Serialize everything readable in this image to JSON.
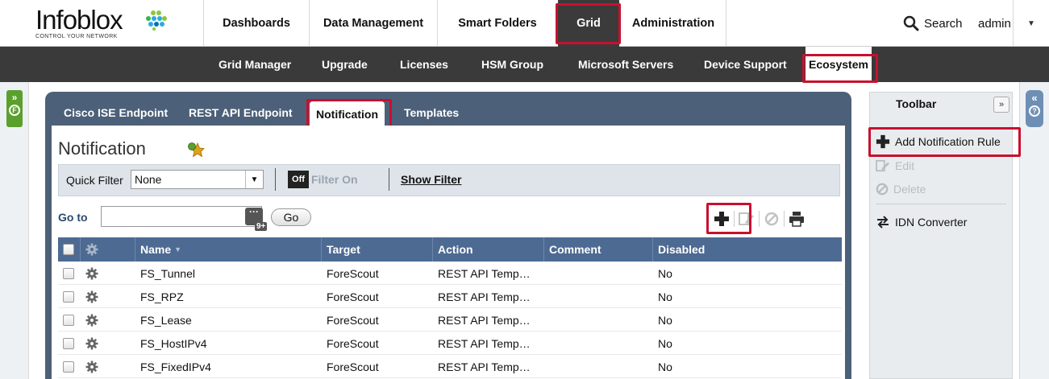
{
  "brand": {
    "name": "Infoblox",
    "tagline": "CONTROL YOUR NETWORK"
  },
  "top_nav": {
    "items": [
      "Dashboards",
      "Data Management",
      "Smart Folders",
      "Grid",
      "Administration"
    ],
    "active": "Grid",
    "search_label": "Search",
    "user": "admin"
  },
  "sub_nav": {
    "items": [
      "Grid Manager",
      "Upgrade",
      "Licenses",
      "HSM Group",
      "Microsoft Servers",
      "Device Support",
      "Ecosystem"
    ],
    "active": "Ecosystem"
  },
  "tabs": {
    "items": [
      "Cisco ISE Endpoint",
      "REST API Endpoint",
      "Notification",
      "Templates"
    ],
    "active": "Notification"
  },
  "page": {
    "title": "Notification"
  },
  "filter": {
    "quick_filter_label": "Quick Filter",
    "quick_filter_value": "None",
    "toggle_label": "Off",
    "filter_on_label": "Filter On",
    "show_filter_label": "Show Filter"
  },
  "goto": {
    "label": "Go to",
    "value": "",
    "more_badge": "9+",
    "go_label": "Go"
  },
  "table": {
    "columns": [
      "Name",
      "Target",
      "Action",
      "Comment",
      "Disabled"
    ],
    "rows": [
      {
        "name": "FS_Tunnel",
        "target": "ForeScout",
        "action": "REST API Temp…",
        "comment": "",
        "disabled": "No"
      },
      {
        "name": "FS_RPZ",
        "target": "ForeScout",
        "action": "REST API Temp…",
        "comment": "",
        "disabled": "No"
      },
      {
        "name": "FS_Lease",
        "target": "ForeScout",
        "action": "REST API Temp…",
        "comment": "",
        "disabled": "No"
      },
      {
        "name": "FS_HostIPv4",
        "target": "ForeScout",
        "action": "REST API Temp…",
        "comment": "",
        "disabled": "No"
      },
      {
        "name": "FS_FixedIPv4",
        "target": "ForeScout",
        "action": "REST API Temp…",
        "comment": "",
        "disabled": "No"
      }
    ]
  },
  "toolbar": {
    "title": "Toolbar",
    "items": [
      "Add Notification Rule",
      "Edit",
      "Delete",
      "IDN Converter"
    ]
  },
  "colors": {
    "highlight": "#c8102e",
    "panel": "#4d6079",
    "header_dark": "#3a3a3a",
    "table_header": "#4d6a93"
  }
}
